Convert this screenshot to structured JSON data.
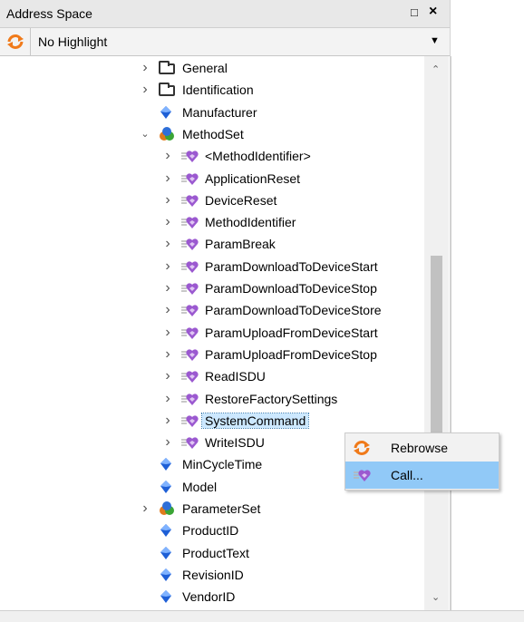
{
  "panel": {
    "title": "Address Space",
    "pin_glyph": "❐",
    "close_glyph": "×"
  },
  "toolbar": {
    "refresh_icon": "refresh-icon",
    "highlight_value": "No Highlight"
  },
  "colors": {
    "selection_fill": "#cce8ff",
    "menu_hover": "#91c9f7",
    "refresh_orange": "#f07a1a",
    "var_blue": "#1e5fd6",
    "method_purple": "#9b59d0"
  },
  "tree": {
    "items": [
      {
        "label": "General",
        "icon": "folder-icon",
        "expander": "collapsed",
        "depth": 0
      },
      {
        "label": "Identification",
        "icon": "folder-icon",
        "expander": "collapsed",
        "depth": 0
      },
      {
        "label": "Manufacturer",
        "icon": "variable-icon",
        "expander": "none",
        "depth": 0
      },
      {
        "label": "MethodSet",
        "icon": "object-icon",
        "expander": "expanded",
        "depth": 0
      },
      {
        "label": "<MethodIdentifier>",
        "icon": "method-icon",
        "expander": "collapsed",
        "depth": 1
      },
      {
        "label": "ApplicationReset",
        "icon": "method-icon",
        "expander": "collapsed",
        "depth": 1
      },
      {
        "label": "DeviceReset",
        "icon": "method-icon",
        "expander": "collapsed",
        "depth": 1
      },
      {
        "label": "MethodIdentifier",
        "icon": "method-icon",
        "expander": "collapsed",
        "depth": 1
      },
      {
        "label": "ParamBreak",
        "icon": "method-icon",
        "expander": "collapsed",
        "depth": 1
      },
      {
        "label": "ParamDownloadToDeviceStart",
        "icon": "method-icon",
        "expander": "collapsed",
        "depth": 1
      },
      {
        "label": "ParamDownloadToDeviceStop",
        "icon": "method-icon",
        "expander": "collapsed",
        "depth": 1
      },
      {
        "label": "ParamDownloadToDeviceStore",
        "icon": "method-icon",
        "expander": "collapsed",
        "depth": 1
      },
      {
        "label": "ParamUploadFromDeviceStart",
        "icon": "method-icon",
        "expander": "collapsed",
        "depth": 1
      },
      {
        "label": "ParamUploadFromDeviceStop",
        "icon": "method-icon",
        "expander": "collapsed",
        "depth": 1
      },
      {
        "label": "ReadISDU",
        "icon": "method-icon",
        "expander": "collapsed",
        "depth": 1
      },
      {
        "label": "RestoreFactorySettings",
        "icon": "method-icon",
        "expander": "collapsed",
        "depth": 1
      },
      {
        "label": "SystemCommand",
        "icon": "method-icon",
        "expander": "collapsed",
        "depth": 1,
        "selected": true
      },
      {
        "label": "WriteISDU",
        "icon": "method-icon",
        "expander": "collapsed",
        "depth": 1
      },
      {
        "label": "MinCycleTime",
        "icon": "variable-icon",
        "expander": "none",
        "depth": 0
      },
      {
        "label": "Model",
        "icon": "variable-icon",
        "expander": "none",
        "depth": 0
      },
      {
        "label": "ParameterSet",
        "icon": "object-icon",
        "expander": "collapsed",
        "depth": 0
      },
      {
        "label": "ProductID",
        "icon": "variable-icon",
        "expander": "none",
        "depth": 0
      },
      {
        "label": "ProductText",
        "icon": "variable-icon",
        "expander": "none",
        "depth": 0
      },
      {
        "label": "RevisionID",
        "icon": "variable-icon",
        "expander": "none",
        "depth": 0
      },
      {
        "label": "VendorID",
        "icon": "variable-icon",
        "expander": "none",
        "depth": 0
      }
    ]
  },
  "context_menu": {
    "items": [
      {
        "label": "Rebrowse",
        "icon": "refresh-icon",
        "hover": false
      },
      {
        "label": "Call...",
        "icon": "method-icon",
        "hover": true
      }
    ]
  }
}
